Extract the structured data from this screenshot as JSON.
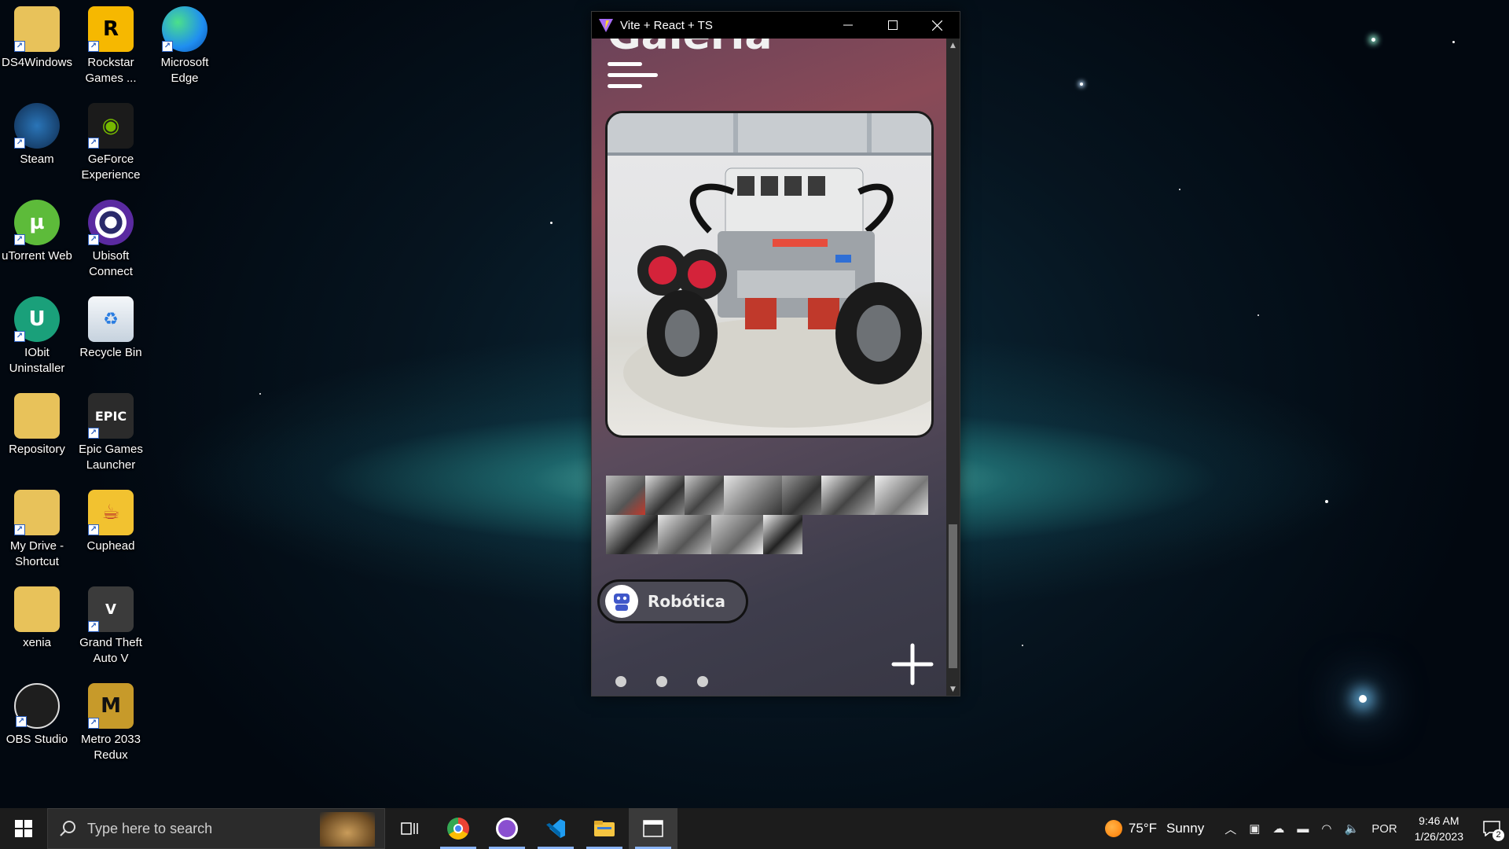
{
  "desktop": {
    "icons": [
      {
        "label": "DS4Windows",
        "icon": "folder-document-icon",
        "color": "#e8c25a"
      },
      {
        "label": "Rockstar Games ...",
        "icon": "rockstar-icon",
        "color": "#f6b800"
      },
      {
        "label": "Microsoft Edge",
        "icon": "edge-icon",
        "color": "#1f8ef1"
      },
      {
        "label": "Steam",
        "icon": "steam-icon",
        "color": "#1b5e95"
      },
      {
        "label": "GeForce Experience",
        "icon": "geforce-icon",
        "color": "#76b900"
      },
      {
        "label": "uTorrent Web",
        "icon": "utorrent-icon",
        "color": "#5dbb3a"
      },
      {
        "label": "Ubisoft Connect",
        "icon": "ubisoft-icon",
        "color": "#2a2a6a"
      },
      {
        "label": "IObit Uninstaller",
        "icon": "iobit-icon",
        "color": "#1aa07a"
      },
      {
        "label": "Recycle Bin",
        "icon": "recycle-bin-icon",
        "color": "#dfe6ee"
      },
      {
        "label": "Repository",
        "icon": "folder-icon",
        "color": "#e8c25a"
      },
      {
        "label": "Epic Games Launcher",
        "icon": "epic-games-icon",
        "color": "#2b2b2b"
      },
      {
        "label": "My Drive - Shortcut",
        "icon": "google-drive-folder-icon",
        "color": "#e8c25a"
      },
      {
        "label": "Cuphead",
        "icon": "cuphead-icon",
        "color": "#f2c230"
      },
      {
        "label": "xenia",
        "icon": "folder-icon",
        "color": "#e8c25a"
      },
      {
        "label": "Grand Theft Auto V",
        "icon": "gta-icon",
        "color": "#3b3b3b"
      },
      {
        "label": "OBS Studio",
        "icon": "obs-icon",
        "color": "#1e1e1e"
      },
      {
        "label": "Metro 2033 Redux",
        "icon": "metro-icon",
        "color": "#c79a2a"
      }
    ]
  },
  "window": {
    "title": "Vite + React + TS",
    "page_heading": "Galeria",
    "category_label": "Robótica",
    "gallery_thumb_count": 11,
    "carousel_dots": 3
  },
  "taskbar": {
    "search_placeholder": "Type here to search",
    "weather_temp": "75°F",
    "weather_text": "Sunny",
    "language": "POR",
    "time": "9:46 AM",
    "date": "1/26/2023",
    "notification_count": "2",
    "apps": [
      "task-view-icon",
      "chrome-icon",
      "github-desktop-icon",
      "vscode-icon",
      "file-explorer-icon",
      "app-window-icon"
    ]
  }
}
